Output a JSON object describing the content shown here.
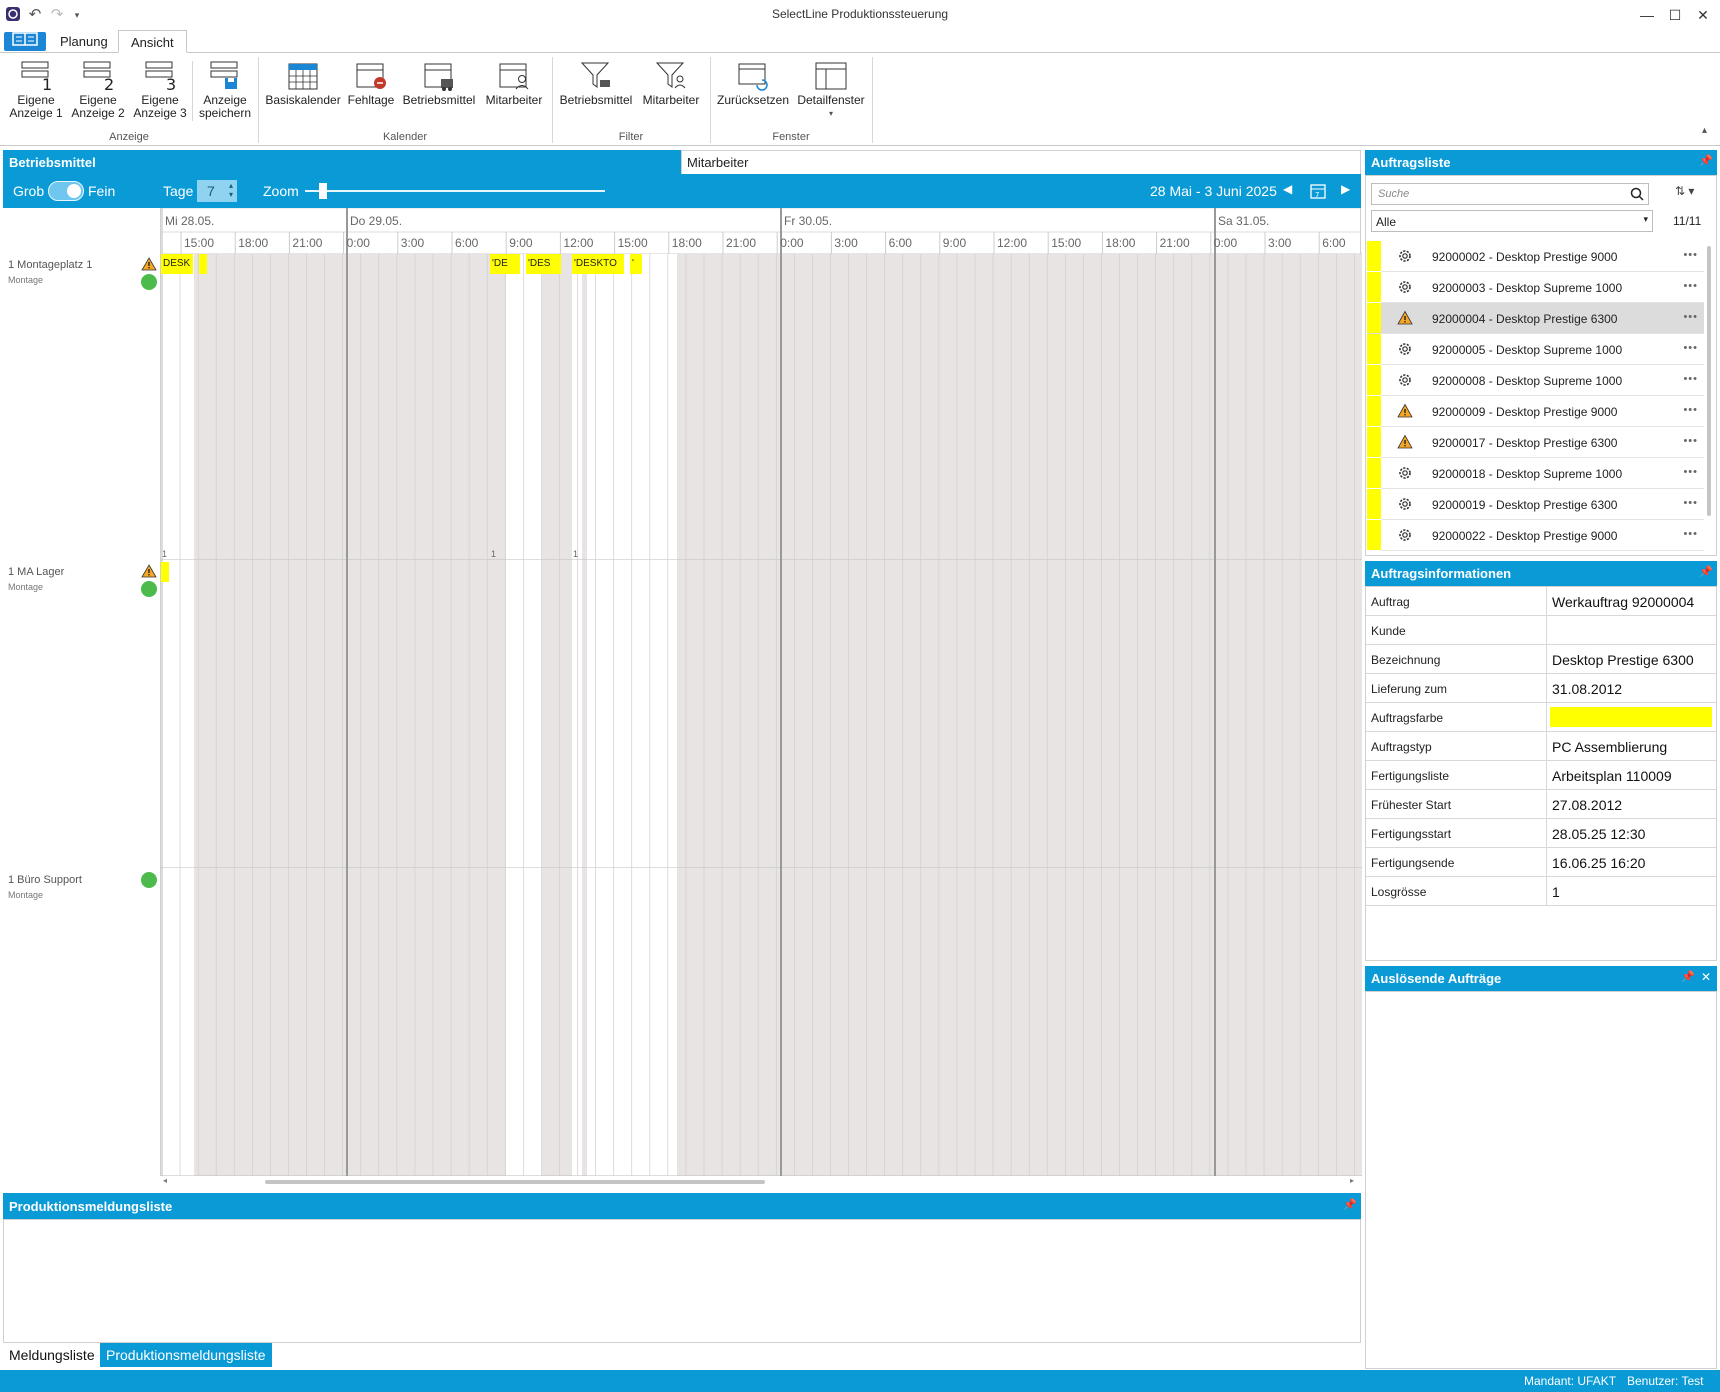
{
  "window": {
    "title": "SelectLine Produktionssteuerung"
  },
  "ribbon_tabs": [
    "Planung",
    "Ansicht"
  ],
  "ribbon": {
    "buttons": [
      {
        "line1": "Eigene",
        "line2": "Anzeige 1"
      },
      {
        "line1": "Eigene",
        "line2": "Anzeige 2"
      },
      {
        "line1": "Eigene",
        "line2": "Anzeige 3"
      },
      {
        "line1": "Anzeige",
        "line2": "speichern"
      },
      {
        "line1": "Basiskalender",
        "line2": ""
      },
      {
        "line1": "Fehltage",
        "line2": ""
      },
      {
        "line1": "Betriebsmittel",
        "line2": ""
      },
      {
        "line1": "Mitarbeiter",
        "line2": ""
      },
      {
        "line1": "Betriebsmittel",
        "line2": ""
      },
      {
        "line1": "Mitarbeiter",
        "line2": ""
      },
      {
        "line1": "Zurücksetzen",
        "line2": ""
      },
      {
        "line1": "Detailfenster",
        "line2": ""
      }
    ],
    "groups": [
      "Anzeige",
      "Kalender",
      "Filter",
      "Fenster"
    ]
  },
  "planner": {
    "tab_betriebsmittel": "Betriebsmittel",
    "tab_mitarbeiter": "Mitarbeiter",
    "grob": "Grob",
    "fein": "Fein",
    "tage_label": "Tage",
    "tage_value": "7",
    "zoom_label": "Zoom",
    "date_range": "28 Mai - 3 Juni 2025",
    "days": [
      "Mi 28.05.",
      "Do 29.05.",
      "Fr 30.05.",
      "Sa 31.05."
    ],
    "hours": [
      "15:00",
      "18:00",
      "21:00",
      "0:00",
      "3:00",
      "6:00",
      "9:00",
      "12:00",
      "15:00",
      "18:00",
      "21:00",
      "0:00",
      "3:00",
      "6:00",
      "9:00",
      "12:00",
      "15:00",
      "18:00",
      "21:00",
      "0:00",
      "3:00",
      "6:00"
    ],
    "resources": [
      {
        "name": "1 Montageplatz 1",
        "sub": "Montage"
      },
      {
        "name": "1 MA Lager",
        "sub": "Montage"
      },
      {
        "name": "1 Büro Support",
        "sub": "Montage"
      }
    ],
    "tasks": [
      "DESK",
      "'DE",
      "'DES",
      "'DESKTO",
      "'"
    ],
    "row_counts": [
      "1",
      "1",
      "1"
    ]
  },
  "auftragsliste": {
    "title": "Auftragsliste",
    "search_placeholder": "Suche",
    "filter_value": "Alle",
    "count": "11/11",
    "items": [
      {
        "text": "92000002 - Desktop Prestige 9000",
        "icon": "gear-icon"
      },
      {
        "text": "92000003 - Desktop Supreme 1000",
        "icon": "gear-icon"
      },
      {
        "text": "92000004 - Desktop Prestige 6300",
        "icon": "warning-icon"
      },
      {
        "text": "92000005 - Desktop Supreme 1000",
        "icon": "gear-icon"
      },
      {
        "text": "92000008 - Desktop Supreme 1000",
        "icon": "gear-icon"
      },
      {
        "text": "92000009 - Desktop Prestige 9000",
        "icon": "warning-icon"
      },
      {
        "text": "92000017 - Desktop Prestige 6300",
        "icon": "warning-icon"
      },
      {
        "text": "92000018 - Desktop Supreme 1000",
        "icon": "gear-icon"
      },
      {
        "text": "92000019 - Desktop Prestige 6300",
        "icon": "gear-icon"
      },
      {
        "text": "92000022 - Desktop Prestige 9000",
        "icon": "gear-icon"
      }
    ]
  },
  "auftragsinformationen": {
    "title": "Auftragsinformationen",
    "rows": [
      {
        "key": "Auftrag",
        "value": "Werkauftrag 92000004"
      },
      {
        "key": "Kunde",
        "value": ""
      },
      {
        "key": "Bezeichnung",
        "value": "Desktop Prestige 6300"
      },
      {
        "key": "Lieferung zum",
        "value": "31.08.2012"
      },
      {
        "key": "Auftragsfarbe",
        "value": ""
      },
      {
        "key": "Auftragstyp",
        "value": "PC Assemblierung"
      },
      {
        "key": "Fertigungsliste",
        "value": "Arbeitsplan 110009"
      },
      {
        "key": "Frühester Start",
        "value": "27.08.2012"
      },
      {
        "key": "Fertigungsstart",
        "value": "28.05.25 12:30"
      },
      {
        "key": "Fertigungsende",
        "value": "16.06.25 16:20"
      },
      {
        "key": "Losgrösse",
        "value": "1"
      }
    ],
    "color": "#ffff00"
  },
  "ausloesende": {
    "title": "Auslösende Aufträge"
  },
  "produktion": {
    "title": "Produktionsmeldungsliste",
    "tabs": [
      "Meldungsliste",
      "Produktionsmeldungsliste"
    ]
  },
  "status": {
    "mandant": "Mandant:  UFAKT",
    "benutzer": "Benutzer:  Test"
  },
  "colors": {
    "accent": "#0a9ad6",
    "task": "#ffff00",
    "ok": "#4cbb4c",
    "warn": "#f5a623"
  }
}
